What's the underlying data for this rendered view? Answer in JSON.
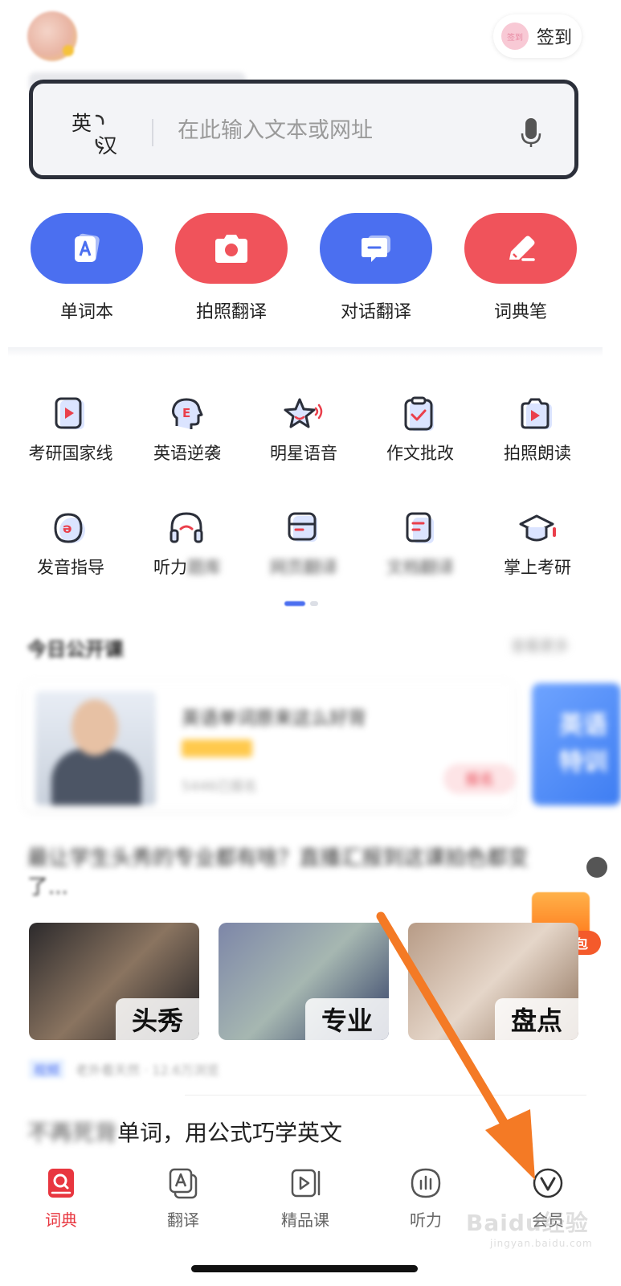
{
  "header": {
    "checkin_badge": "签到",
    "checkin_label": "签到"
  },
  "search": {
    "lang_from": "英",
    "lang_to": "汉",
    "placeholder": "在此输入文本或网址"
  },
  "primary_actions": [
    {
      "label": "单词本",
      "icon": "vocabulary-book-icon",
      "color": "#4b6ff0"
    },
    {
      "label": "拍照翻译",
      "icon": "camera-icon",
      "color": "#f0535b"
    },
    {
      "label": "对话翻译",
      "icon": "chat-bubble-icon",
      "color": "#4b6ff0"
    },
    {
      "label": "词典笔",
      "icon": "pen-icon",
      "color": "#f0535b"
    }
  ],
  "feature_grid": {
    "row1": [
      {
        "label": "考研国家线",
        "icon": "play-card-icon"
      },
      {
        "label": "英语逆袭",
        "icon": "head-e-icon"
      },
      {
        "label": "明星语音",
        "icon": "star-voice-icon"
      },
      {
        "label": "作文批改",
        "icon": "clipboard-check-icon"
      },
      {
        "label": "拍照朗读",
        "icon": "camera-play-icon"
      }
    ],
    "row2": [
      {
        "label": "发音指导",
        "icon": "pronunciation-icon"
      },
      {
        "label": "听力",
        "icon": "headphones-icon"
      },
      {
        "label": "",
        "icon": "web-page-icon"
      },
      {
        "label": "",
        "icon": "document-icon"
      },
      {
        "label": "掌上考研",
        "icon": "graduation-cap-icon"
      }
    ]
  },
  "open_class": {
    "title": "今日公开课"
  },
  "gift": {
    "label": "礼包"
  },
  "article": {
    "title": "了..."
  },
  "videos": [
    {
      "tag": "头秀"
    },
    {
      "tag": "专业"
    },
    {
      "tag": "盘点"
    }
  ],
  "bottom_article": {
    "title_visible": "单词，用公式巧学英文"
  },
  "tabbar": [
    {
      "label": "词典",
      "icon": "dictionary-icon",
      "active": true
    },
    {
      "label": "翻译",
      "icon": "translate-icon",
      "active": false
    },
    {
      "label": "精品课",
      "icon": "course-icon",
      "active": false
    },
    {
      "label": "听力",
      "icon": "listening-icon",
      "active": false
    },
    {
      "label": "会员",
      "icon": "vip-icon",
      "active": false
    }
  ],
  "colors": {
    "accent_blue": "#4b6ff0",
    "accent_red": "#f0535b",
    "annotation_arrow": "#f47a25"
  },
  "watermark": {
    "brand": "Baidu经验",
    "url": "jingyan.baidu.com"
  }
}
